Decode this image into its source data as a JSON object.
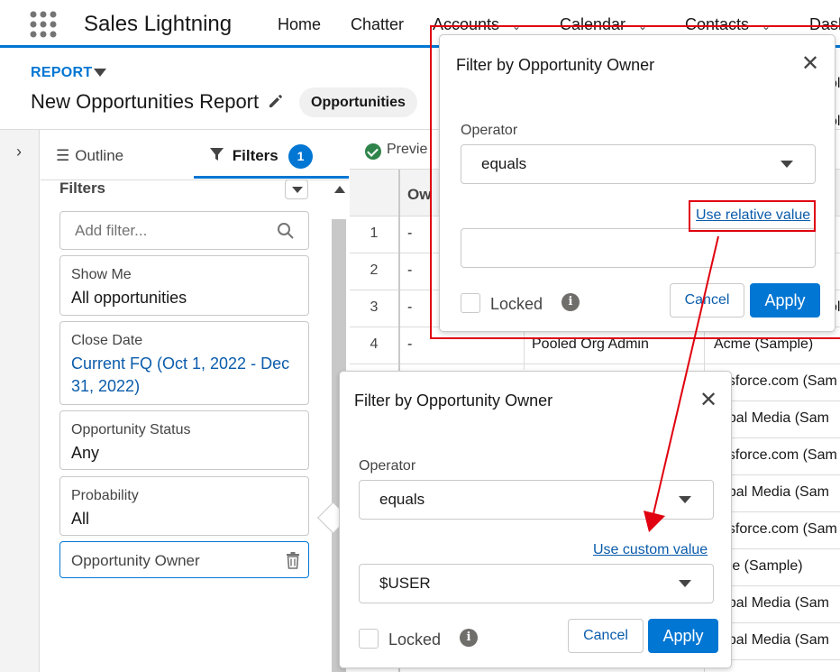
{
  "app": {
    "name": "Sales Lightning",
    "nav": [
      "Home",
      "Chatter",
      "Accounts",
      "Calendar",
      "Contacts",
      "Dash"
    ]
  },
  "report": {
    "label": "REPORT",
    "title": "New Opportunities Report",
    "type_badge": "Opportunities"
  },
  "panel": {
    "tab_outline": "Outline",
    "tab_filters": "Filters",
    "filters_count": "1",
    "heading": "Filters",
    "add_filter_placeholder": "Add filter...",
    "cards": [
      {
        "label": "Show Me",
        "value": "All opportunities"
      },
      {
        "label": "Close Date",
        "value": "Current FQ (Oct 1, 2022 - Dec 31, 2022)"
      },
      {
        "label": "Opportunity Status",
        "value": "Any"
      },
      {
        "label": "Probability",
        "value": "All"
      },
      {
        "label": "Opportunity Owner",
        "value": ""
      }
    ]
  },
  "preview": {
    "label": "Previe",
    "owner_col": "Ow",
    "rows": [
      {
        "num": "1",
        "c1": "-",
        "c2": "",
        "c3": ""
      },
      {
        "num": "2",
        "c1": "-",
        "c2": "",
        "c3": ""
      },
      {
        "num": "3",
        "c1": "-",
        "c2": "",
        "c3": ""
      },
      {
        "num": "4",
        "c1": "-",
        "c2": "Pooled Org Admin",
        "c3": "Acme (Sample)"
      },
      {
        "num": "",
        "c1": "",
        "c2": "",
        "c3": "esforce.com (Sam"
      },
      {
        "num": "",
        "c1": "",
        "c2": "",
        "c3": "obal Media (Sam"
      },
      {
        "num": "",
        "c1": "",
        "c2": "",
        "c3": "esforce.com (Sam"
      },
      {
        "num": "",
        "c1": "",
        "c2": "",
        "c3": "obal Media (Sam"
      },
      {
        "num": "",
        "c1": "",
        "c2": "",
        "c3": "esforce.com (Sam"
      },
      {
        "num": "",
        "c1": "",
        "c2": "",
        "c3": "me (Sample)"
      },
      {
        "num": "",
        "c1": "",
        "c2": "",
        "c3": "obal Media (Sam"
      },
      {
        "num": "",
        "c1": "",
        "c2": "",
        "c3": "obal Media (Sam"
      }
    ],
    "edge_fragments": [
      "ol",
      "ol",
      "ol"
    ]
  },
  "popover_top": {
    "title": "Filter by Opportunity Owner",
    "operator_label": "Operator",
    "operator_value": "equals",
    "link": "Use relative value",
    "value": "",
    "locked_label": "Locked",
    "cancel": "Cancel",
    "apply": "Apply"
  },
  "popover_bottom": {
    "title": "Filter by Opportunity Owner",
    "operator_label": "Operator",
    "operator_value": "equals",
    "link": "Use custom value",
    "value": "$USER",
    "locked_label": "Locked",
    "cancel": "Cancel",
    "apply": "Apply"
  },
  "colors": {
    "brand": "#0176d3",
    "annotation": "#e0000f",
    "success": "#2e844a"
  }
}
